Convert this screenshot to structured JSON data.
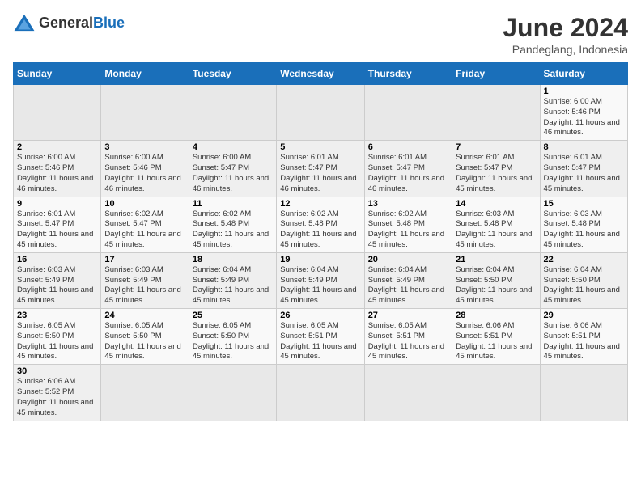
{
  "header": {
    "logo_general": "General",
    "logo_blue": "Blue",
    "month_year": "June 2024",
    "location": "Pandeglang, Indonesia"
  },
  "weekdays": [
    "Sunday",
    "Monday",
    "Tuesday",
    "Wednesday",
    "Thursday",
    "Friday",
    "Saturday"
  ],
  "weeks": [
    [
      {
        "day": "",
        "info": ""
      },
      {
        "day": "",
        "info": ""
      },
      {
        "day": "",
        "info": ""
      },
      {
        "day": "",
        "info": ""
      },
      {
        "day": "",
        "info": ""
      },
      {
        "day": "",
        "info": ""
      },
      {
        "day": "1",
        "info": "Sunrise: 6:00 AM\nSunset: 5:46 PM\nDaylight: 11 hours and 46 minutes."
      }
    ],
    [
      {
        "day": "2",
        "info": "Sunrise: 6:00 AM\nSunset: 5:46 PM\nDaylight: 11 hours and 46 minutes."
      },
      {
        "day": "3",
        "info": "Sunrise: 6:00 AM\nSunset: 5:46 PM\nDaylight: 11 hours and 46 minutes."
      },
      {
        "day": "4",
        "info": "Sunrise: 6:00 AM\nSunset: 5:47 PM\nDaylight: 11 hours and 46 minutes."
      },
      {
        "day": "5",
        "info": "Sunrise: 6:01 AM\nSunset: 5:47 PM\nDaylight: 11 hours and 46 minutes."
      },
      {
        "day": "6",
        "info": "Sunrise: 6:01 AM\nSunset: 5:47 PM\nDaylight: 11 hours and 46 minutes."
      },
      {
        "day": "7",
        "info": "Sunrise: 6:01 AM\nSunset: 5:47 PM\nDaylight: 11 hours and 45 minutes."
      },
      {
        "day": "8",
        "info": "Sunrise: 6:01 AM\nSunset: 5:47 PM\nDaylight: 11 hours and 45 minutes."
      }
    ],
    [
      {
        "day": "9",
        "info": "Sunrise: 6:01 AM\nSunset: 5:47 PM\nDaylight: 11 hours and 45 minutes."
      },
      {
        "day": "10",
        "info": "Sunrise: 6:02 AM\nSunset: 5:47 PM\nDaylight: 11 hours and 45 minutes."
      },
      {
        "day": "11",
        "info": "Sunrise: 6:02 AM\nSunset: 5:48 PM\nDaylight: 11 hours and 45 minutes."
      },
      {
        "day": "12",
        "info": "Sunrise: 6:02 AM\nSunset: 5:48 PM\nDaylight: 11 hours and 45 minutes."
      },
      {
        "day": "13",
        "info": "Sunrise: 6:02 AM\nSunset: 5:48 PM\nDaylight: 11 hours and 45 minutes."
      },
      {
        "day": "14",
        "info": "Sunrise: 6:03 AM\nSunset: 5:48 PM\nDaylight: 11 hours and 45 minutes."
      },
      {
        "day": "15",
        "info": "Sunrise: 6:03 AM\nSunset: 5:48 PM\nDaylight: 11 hours and 45 minutes."
      }
    ],
    [
      {
        "day": "16",
        "info": "Sunrise: 6:03 AM\nSunset: 5:49 PM\nDaylight: 11 hours and 45 minutes."
      },
      {
        "day": "17",
        "info": "Sunrise: 6:03 AM\nSunset: 5:49 PM\nDaylight: 11 hours and 45 minutes."
      },
      {
        "day": "18",
        "info": "Sunrise: 6:04 AM\nSunset: 5:49 PM\nDaylight: 11 hours and 45 minutes."
      },
      {
        "day": "19",
        "info": "Sunrise: 6:04 AM\nSunset: 5:49 PM\nDaylight: 11 hours and 45 minutes."
      },
      {
        "day": "20",
        "info": "Sunrise: 6:04 AM\nSunset: 5:49 PM\nDaylight: 11 hours and 45 minutes."
      },
      {
        "day": "21",
        "info": "Sunrise: 6:04 AM\nSunset: 5:50 PM\nDaylight: 11 hours and 45 minutes."
      },
      {
        "day": "22",
        "info": "Sunrise: 6:04 AM\nSunset: 5:50 PM\nDaylight: 11 hours and 45 minutes."
      }
    ],
    [
      {
        "day": "23",
        "info": "Sunrise: 6:05 AM\nSunset: 5:50 PM\nDaylight: 11 hours and 45 minutes."
      },
      {
        "day": "24",
        "info": "Sunrise: 6:05 AM\nSunset: 5:50 PM\nDaylight: 11 hours and 45 minutes."
      },
      {
        "day": "25",
        "info": "Sunrise: 6:05 AM\nSunset: 5:50 PM\nDaylight: 11 hours and 45 minutes."
      },
      {
        "day": "26",
        "info": "Sunrise: 6:05 AM\nSunset: 5:51 PM\nDaylight: 11 hours and 45 minutes."
      },
      {
        "day": "27",
        "info": "Sunrise: 6:05 AM\nSunset: 5:51 PM\nDaylight: 11 hours and 45 minutes."
      },
      {
        "day": "28",
        "info": "Sunrise: 6:06 AM\nSunset: 5:51 PM\nDaylight: 11 hours and 45 minutes."
      },
      {
        "day": "29",
        "info": "Sunrise: 6:06 AM\nSunset: 5:51 PM\nDaylight: 11 hours and 45 minutes."
      }
    ],
    [
      {
        "day": "30",
        "info": "Sunrise: 6:06 AM\nSunset: 5:52 PM\nDaylight: 11 hours and 45 minutes."
      },
      {
        "day": "",
        "info": ""
      },
      {
        "day": "",
        "info": ""
      },
      {
        "day": "",
        "info": ""
      },
      {
        "day": "",
        "info": ""
      },
      {
        "day": "",
        "info": ""
      },
      {
        "day": "",
        "info": ""
      }
    ]
  ]
}
